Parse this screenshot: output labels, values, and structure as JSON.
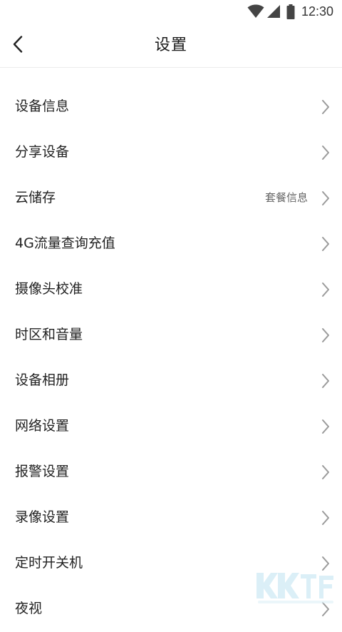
{
  "status_bar": {
    "time": "12:30",
    "icons": [
      "wifi-icon",
      "cellular-signal-icon",
      "battery-icon"
    ]
  },
  "header": {
    "title": "设置",
    "back_icon": "chevron-left-icon"
  },
  "settings": {
    "items": [
      {
        "label": "设备信息",
        "value": ""
      },
      {
        "label": "分享设备",
        "value": ""
      },
      {
        "label": "云储存",
        "value": "套餐信息"
      },
      {
        "label": "4G流量查询充值",
        "value": ""
      },
      {
        "label": "摄像头校准",
        "value": ""
      },
      {
        "label": "时区和音量",
        "value": ""
      },
      {
        "label": "设备相册",
        "value": ""
      },
      {
        "label": "网络设置",
        "value": ""
      },
      {
        "label": "报警设置",
        "value": ""
      },
      {
        "label": "录像设置",
        "value": ""
      },
      {
        "label": "定时开关机",
        "value": ""
      },
      {
        "label": "夜视",
        "value": ""
      }
    ]
  },
  "colors": {
    "background": "#ffffff",
    "text": "#222222",
    "secondary_text": "#666666",
    "chevron": "#9a9a9a",
    "divider": "#ececec"
  }
}
